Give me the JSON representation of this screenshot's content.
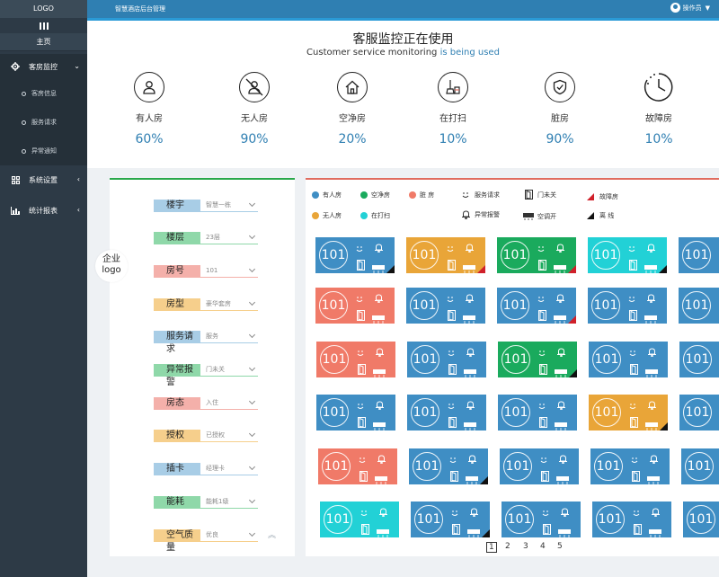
{
  "sidebar": {
    "logo": "LOGO",
    "home": "主页",
    "items": [
      {
        "label": "客房监控",
        "icon": "gear-icon",
        "expanded": true,
        "children": [
          "客房信息",
          "服务请求",
          "异常通知"
        ]
      },
      {
        "label": "系统设置",
        "icon": "grid-icon",
        "expanded": false
      },
      {
        "label": "统计报表",
        "icon": "bar-chart-icon",
        "expanded": false
      }
    ]
  },
  "header": {
    "title": "智慧酒店后台管理",
    "user": "操作员"
  },
  "stats": {
    "title": "客服监控正在使用",
    "subtitle_a": "Customer service monitoring ",
    "subtitle_b": "is being used",
    "items": [
      {
        "label": "有人房",
        "percent": "60%",
        "icon": "person-icon"
      },
      {
        "label": "无人房",
        "percent": "90%",
        "icon": "no-person-icon"
      },
      {
        "label": "空净房",
        "percent": "20%",
        "icon": "house-icon"
      },
      {
        "label": "在打扫",
        "percent": "10%",
        "icon": "cleaning-icon"
      },
      {
        "label": "脏房",
        "percent": "90%",
        "icon": "shield-icon"
      },
      {
        "label": "故障房",
        "percent": "10%",
        "icon": "clock-icon"
      }
    ]
  },
  "filter": {
    "corp_logo_1": "企业",
    "corp_logo_2": "logo",
    "rows": [
      {
        "label": "楼宇",
        "value": "智慧一栋",
        "color": "blue"
      },
      {
        "label": "楼层",
        "value": "23层",
        "color": "green"
      },
      {
        "label": "房号",
        "value": "101",
        "color": "pink"
      },
      {
        "label": "房型",
        "value": "豪华套房",
        "color": "orange"
      },
      {
        "label": "服务请求",
        "value": "服务",
        "color": "blue"
      },
      {
        "label": "异常报警",
        "value": "门未关",
        "color": "green"
      },
      {
        "label": "房态",
        "value": "入住",
        "color": "pink"
      },
      {
        "label": "授权",
        "value": "已授权",
        "color": "orange"
      },
      {
        "label": "插卡",
        "value": "经理卡",
        "color": "blue"
      },
      {
        "label": "能耗",
        "value": "能耗1级",
        "color": "green"
      },
      {
        "label": "空气质量",
        "value": "优良",
        "color": "orange"
      }
    ]
  },
  "legend": {
    "occupied": "有人房",
    "clean": "空净房",
    "dirty": "脏 房",
    "service": "服务请求",
    "door": "门未关",
    "fault": "故障房",
    "vacant": "无人房",
    "cleaning": "在打扫",
    "alarm": "异常报警",
    "ac": "空调开",
    "offline": "离 线"
  },
  "colors": {
    "occupied": "#3f8ec4",
    "vacant": "#e9a538",
    "clean": "#1aaa5d",
    "cleaning": "#22d1d6",
    "dirty": "#f07a68",
    "fault": "#d0202a",
    "offline": "#111111"
  },
  "rooms": {
    "number": "101",
    "grid": [
      [
        {
          "c": "blue",
          "f": "black"
        },
        {
          "c": "orange",
          "f": "red"
        },
        {
          "c": "green",
          "f": "red"
        },
        {
          "c": "cyan",
          "f": "black"
        },
        {
          "c": "blue",
          "f": ""
        }
      ],
      [
        {
          "c": "salmon",
          "f": ""
        },
        {
          "c": "blue",
          "f": ""
        },
        {
          "c": "blue",
          "f": "red"
        },
        {
          "c": "blue",
          "f": ""
        },
        {
          "c": "blue",
          "f": ""
        }
      ],
      [
        {
          "c": "salmon",
          "f": ""
        },
        {
          "c": "blue",
          "f": ""
        },
        {
          "c": "green",
          "f": "black"
        },
        {
          "c": "blue",
          "f": ""
        },
        {
          "c": "blue",
          "f": ""
        }
      ],
      [
        {
          "c": "blue",
          "f": ""
        },
        {
          "c": "blue",
          "f": ""
        },
        {
          "c": "blue",
          "f": ""
        },
        {
          "c": "orange",
          "f": "black"
        },
        {
          "c": "blue",
          "f": ""
        }
      ],
      [
        {
          "c": "salmon",
          "f": ""
        },
        {
          "c": "blue",
          "f": "black"
        },
        {
          "c": "blue",
          "f": ""
        },
        {
          "c": "blue",
          "f": ""
        },
        {
          "c": "blue",
          "f": ""
        }
      ],
      [
        {
          "c": "cyan",
          "f": ""
        },
        {
          "c": "blue",
          "f": "black"
        },
        {
          "c": "blue",
          "f": ""
        },
        {
          "c": "blue",
          "f": ""
        },
        {
          "c": "blue",
          "f": ""
        }
      ]
    ]
  },
  "pager": {
    "pages": [
      "1",
      "2",
      "3",
      "4",
      "5"
    ],
    "current": "1"
  }
}
